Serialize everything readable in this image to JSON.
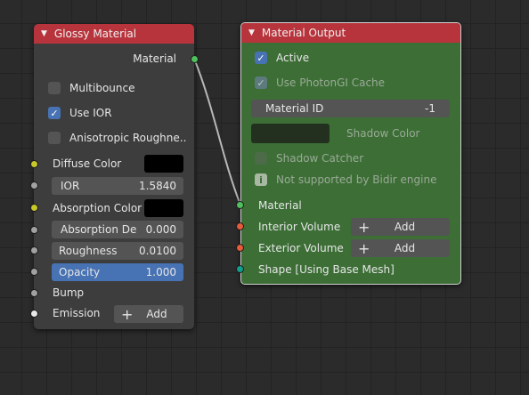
{
  "glossy_node": {
    "title": "Glossy Material",
    "output_label": "Material",
    "multibounce_label": "Multibounce",
    "use_ior_label": "Use IOR",
    "anisotropic_label": "Anisotropic Roughne..",
    "diffuse_color_label": "Diffuse Color",
    "ior_label": "IOR",
    "ior_value": "1.5840",
    "absorption_color_label": "Absorption Color",
    "absorption_depth_label": "Absorption De",
    "absorption_depth_value": "0.000",
    "roughness_label": "Roughness",
    "roughness_value": "0.0100",
    "opacity_label": "Opacity",
    "opacity_value": "1.000",
    "bump_label": "Bump",
    "emission_label": "Emission",
    "add_plus": "+",
    "add_label": "Add"
  },
  "output_node": {
    "title": "Material Output",
    "active_label": "Active",
    "photongi_label": "Use PhotonGI Cache",
    "material_id_label": "Material ID",
    "material_id_value": "-1",
    "shadow_color_label": "Shadow Color",
    "shadow_catcher_label": "Shadow Catcher",
    "info_text": "Not supported by Bidir engine",
    "info_icon": "i",
    "material_label": "Material",
    "interior_volume_label": "Interior Volume",
    "exterior_volume_label": "Exterior Volume",
    "shape_label": "Shape [Using Base Mesh]",
    "add_plus": "+",
    "add_label": "Add"
  },
  "icons": {
    "collapse_arrow": "▼",
    "check": "✓"
  },
  "colors": {
    "header": "#b8343c",
    "glossy_bg": "#3d3d3d",
    "output_bg": "#3c6e36",
    "selection": "#4772b3",
    "socket_shader": "#4fc15c",
    "socket_color": "#c7c729",
    "socket_volume": "#e65b3a",
    "socket_shape": "#129e8c"
  }
}
